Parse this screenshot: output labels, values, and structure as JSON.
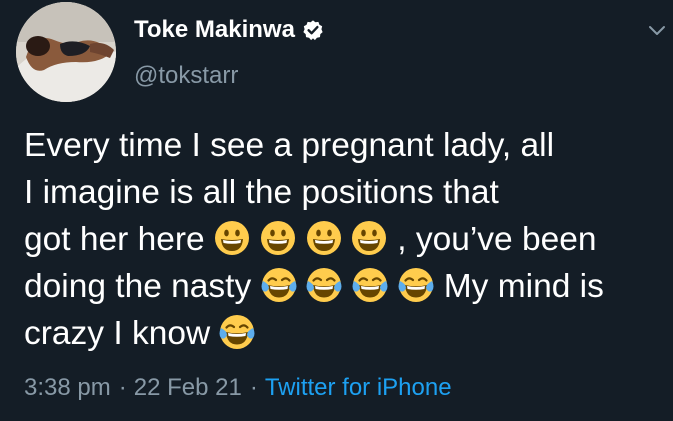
{
  "author": {
    "display_name": "Toke Makinwa",
    "handle": "@tokstarr",
    "verified": true
  },
  "tweet": {
    "lines": [
      [
        "Every time I see a pregnant lady, all"
      ],
      [
        "I imagine is all the positions that"
      ],
      [
        "got her here ",
        ", you’ve been"
      ],
      [
        "doing the nasty ",
        "My mind is"
      ],
      [
        "crazy I know "
      ]
    ],
    "emoji": {
      "grinning": "grinning-face-emoji",
      "laughing": "face-with-tears-of-joy-emoji"
    }
  },
  "meta": {
    "time": "3:38 pm",
    "separator": "·",
    "date": "22 Feb 21",
    "source": "Twitter for iPhone"
  },
  "colors": {
    "background": "#141d26",
    "text": "#ffffff",
    "secondary": "#8899a6",
    "accent": "#1da1f2"
  }
}
